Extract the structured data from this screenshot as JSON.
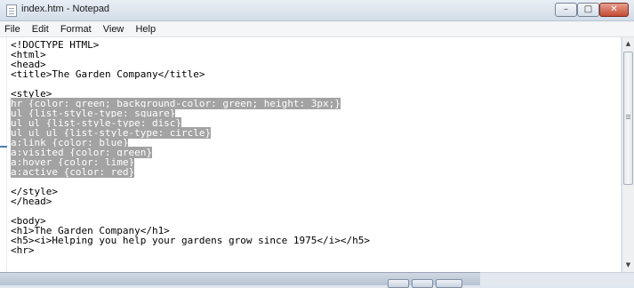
{
  "window": {
    "title": "index.htm - Notepad",
    "controls": {
      "minimize": "–",
      "maximize": "□",
      "close": "✕"
    }
  },
  "menu": [
    "File",
    "Edit",
    "Format",
    "View",
    "Help"
  ],
  "editor": {
    "lines": [
      {
        "text": "<!DOCTYPE HTML>",
        "selected": false
      },
      {
        "text": "<html>",
        "selected": false
      },
      {
        "text": "<head>",
        "selected": false
      },
      {
        "text": "<title>The Garden Company</title>",
        "selected": false
      },
      {
        "text": "",
        "selected": false
      },
      {
        "text": "<style>",
        "selected": false
      },
      {
        "text": "hr {color: green; background-color: green; height: 3px;}",
        "selected": true
      },
      {
        "text": "ul {list-style-type: square}",
        "selected": true
      },
      {
        "text": "ul ul {list-style-type: disc}",
        "selected": true
      },
      {
        "text": "ul ul ul {list-style-type: circle}",
        "selected": true
      },
      {
        "text": "a:link {color: blue}",
        "selected": true
      },
      {
        "text": "a:visited {color: green}",
        "selected": true
      },
      {
        "text": "a:hover {color: lime}",
        "selected": true
      },
      {
        "text": "a:active {color: red}",
        "selected": true
      },
      {
        "text": "",
        "selected": false
      },
      {
        "text": "</style>",
        "selected": false
      },
      {
        "text": "</head>",
        "selected": false
      },
      {
        "text": "",
        "selected": false
      },
      {
        "text": "<body>",
        "selected": false
      },
      {
        "text": "<h1>The Garden Company</h1>",
        "selected": false
      },
      {
        "text": "<h5><i>Helping you help your gardens grow since 1975</i></h5>",
        "selected": false
      },
      {
        "text": "<hr>",
        "selected": false
      }
    ]
  },
  "scrollbar": {
    "up_arrow": "▲",
    "down_arrow": "▼"
  },
  "colors": {
    "selection": "#a3a3a3",
    "accent": "#4a7fb0",
    "close": "#c44a33"
  }
}
